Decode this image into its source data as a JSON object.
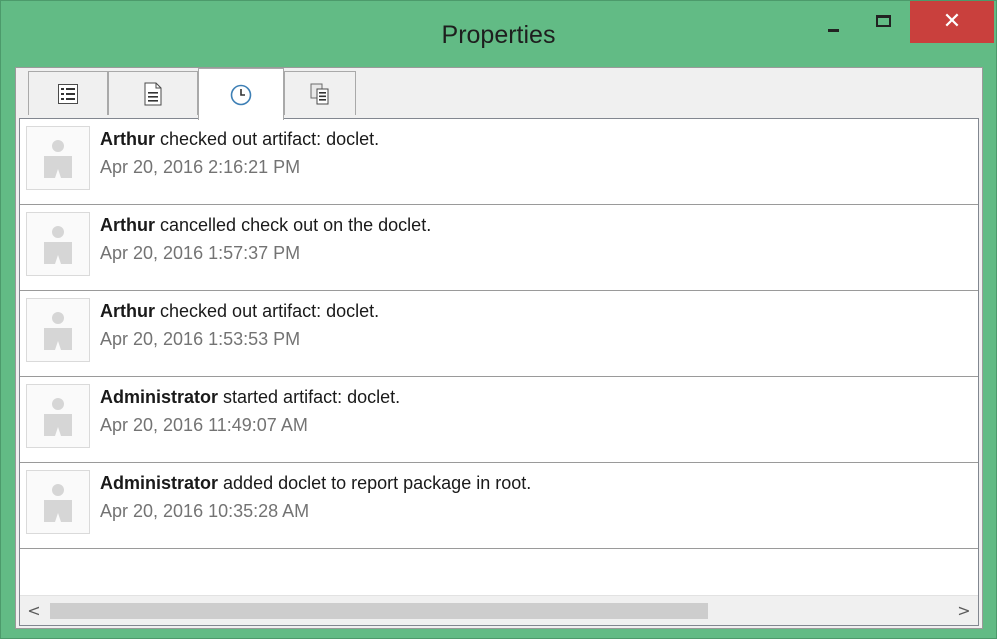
{
  "window": {
    "title": "Properties",
    "controls": {
      "minimize": "minimize",
      "maximize": "maximize",
      "close": "✕"
    },
    "accent_color": "#62bb85",
    "close_color": "#c9403d"
  },
  "tabs": [
    {
      "icon": "list-details-icon",
      "active": false
    },
    {
      "icon": "document-icon",
      "active": false
    },
    {
      "icon": "clock-history-icon",
      "active": true
    },
    {
      "icon": "copy-documents-icon",
      "active": false
    }
  ],
  "history": [
    {
      "user": "Arthur",
      "action": "checked out artifact: doclet.",
      "timestamp": "Apr 20, 2016 2:16:21 PM"
    },
    {
      "user": "Arthur",
      "action": "cancelled check out on the doclet.",
      "timestamp": "Apr 20, 2016 1:57:37 PM"
    },
    {
      "user": "Arthur",
      "action": "checked out artifact: doclet.",
      "timestamp": "Apr 20, 2016 1:53:53 PM"
    },
    {
      "user": "Administrator",
      "action": "started artifact: doclet.",
      "timestamp": "Apr 20, 2016 11:49:07 AM"
    },
    {
      "user": "Administrator",
      "action": "added doclet to report package in root.",
      "timestamp": "Apr 20, 2016 10:35:28 AM"
    }
  ],
  "scrollbar": {
    "left_arrow": "<",
    "right_arrow": ">"
  }
}
